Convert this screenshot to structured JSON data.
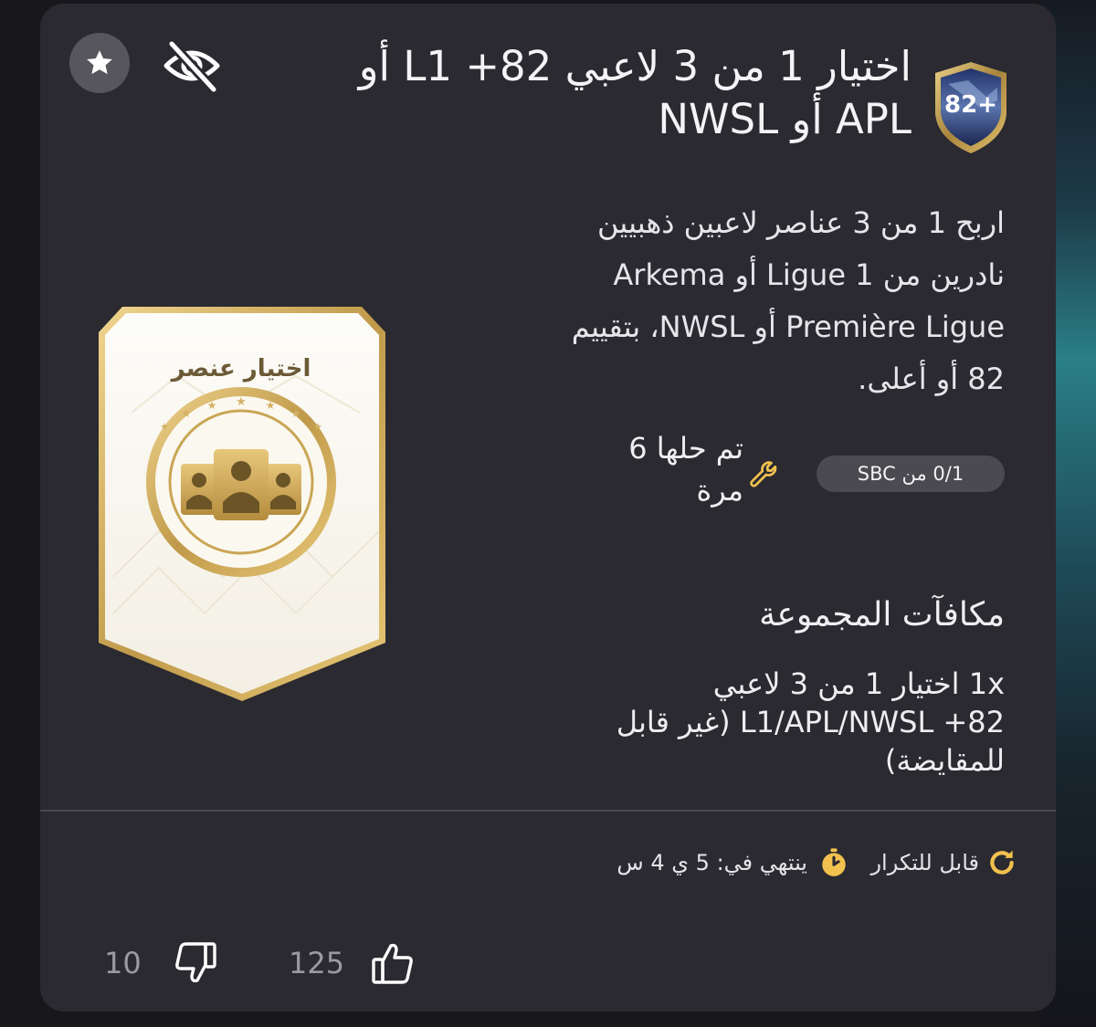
{
  "sbc": {
    "title": "اختيار 1 من 3 لاعبي L1 +82 أو APL أو NWSL",
    "badge_text": "82+",
    "description": "اربح 1 من 3 عناصر لاعبين ذهبيين نادرين من Ligue 1 أو Arkema Première Ligue أو NWSL، بتقييم 82 أو أعلى.",
    "solved_text": "تم حلها 6 مرة",
    "progress_text": "0/1 من SBC",
    "progress_fraction": 0
  },
  "pack": {
    "label": "اختيار عنصر"
  },
  "rewards": {
    "heading": "مكافآت المجموعة",
    "items": [
      {
        "text": "1x اختيار 1 من 3 لاعبي L1/APL/NWSL +82 (غير قابل للمقايضة)"
      }
    ]
  },
  "footer": {
    "repeatable_label": "قابل للتكرار",
    "expires_text": "ينتهي في: 5 ي 4 س"
  },
  "votes": {
    "up": "125",
    "down": "10"
  },
  "colors": {
    "background": "#17171c",
    "card": "#2b2a31",
    "accent_gold": "#f2c14e",
    "pill": "#4a4a50",
    "muted_text": "#9b9aa1"
  },
  "icons": {
    "favorite": "star-icon",
    "hide": "eye-off-icon",
    "solved": "wrench-icon",
    "repeatable": "refresh-icon",
    "timer": "stopwatch-icon",
    "like": "thumbs-up-icon",
    "dislike": "thumbs-down-icon"
  }
}
